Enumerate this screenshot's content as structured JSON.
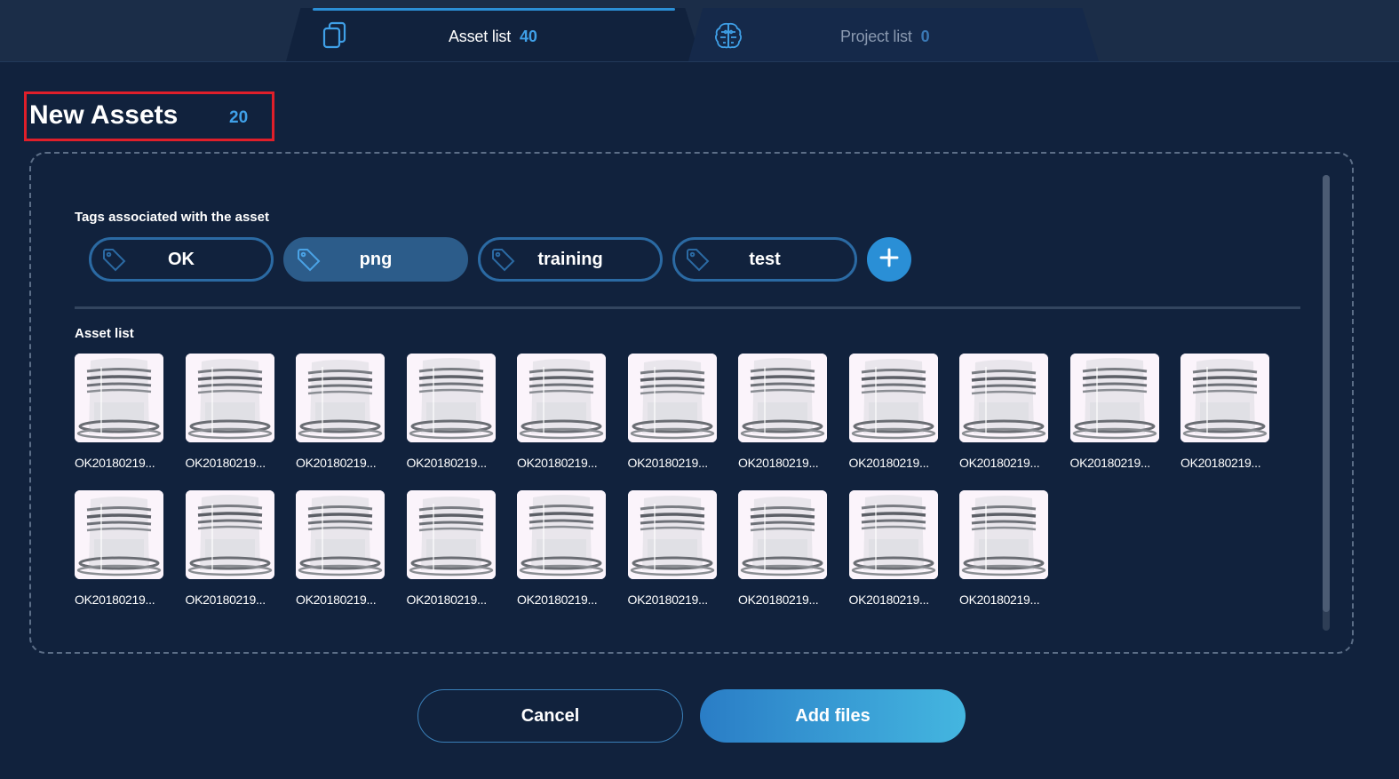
{
  "tabs": [
    {
      "label": "Asset list",
      "count": "40",
      "icon": "copy-icon",
      "active": true
    },
    {
      "label": "Project list",
      "count": "0",
      "icon": "brain-icon",
      "active": false
    }
  ],
  "header": {
    "title": "New Assets",
    "count": "20"
  },
  "tags_section": {
    "label": "Tags associated with the asset",
    "tags": [
      {
        "label": "OK",
        "selected": false
      },
      {
        "label": "png",
        "selected": true
      },
      {
        "label": "training",
        "selected": false
      },
      {
        "label": "test",
        "selected": false
      }
    ],
    "add_icon": "plus-icon"
  },
  "assets_section": {
    "label": "Asset list",
    "assets": [
      {
        "name": "OK20180219..."
      },
      {
        "name": "OK20180219..."
      },
      {
        "name": "OK20180219..."
      },
      {
        "name": "OK20180219..."
      },
      {
        "name": "OK20180219..."
      },
      {
        "name": "OK20180219..."
      },
      {
        "name": "OK20180219..."
      },
      {
        "name": "OK20180219..."
      },
      {
        "name": "OK20180219..."
      },
      {
        "name": "OK20180219..."
      },
      {
        "name": "OK20180219..."
      },
      {
        "name": "OK20180219..."
      },
      {
        "name": "OK20180219..."
      },
      {
        "name": "OK20180219..."
      },
      {
        "name": "OK20180219..."
      },
      {
        "name": "OK20180219..."
      },
      {
        "name": "OK20180219..."
      },
      {
        "name": "OK20180219..."
      },
      {
        "name": "OK20180219..."
      },
      {
        "name": "OK20180219..."
      }
    ]
  },
  "footer": {
    "cancel_label": "Cancel",
    "add_label": "Add files"
  },
  "colors": {
    "accent": "#2a8fd6",
    "background": "#11223d",
    "highlight_box": "#e01f2a"
  }
}
